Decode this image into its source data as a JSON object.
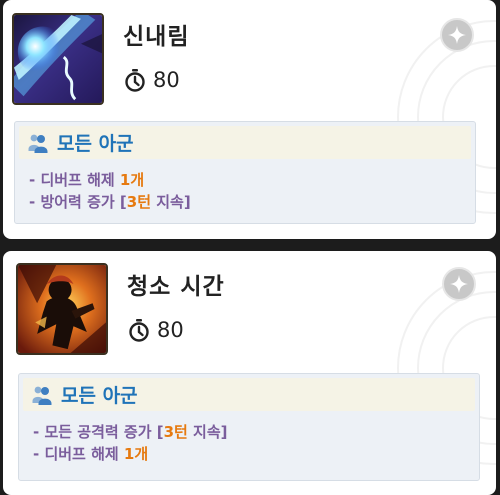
{
  "skills": [
    {
      "name": "신내림",
      "icon": "lightning-slash-icon",
      "cooldown": "80",
      "target": "모든 아군",
      "effects": [
        {
          "prefix": "- ",
          "text": "디버프 해제 ",
          "value": "1개",
          "suffix": ""
        },
        {
          "prefix": "- ",
          "text": "방어력 증가 [",
          "value": "3턴",
          "suffix": " 지속]"
        }
      ]
    },
    {
      "name": "청소 시간",
      "icon": "shadow-figure-icon",
      "cooldown": "80",
      "target": "모든 아군",
      "effects": [
        {
          "prefix": "- ",
          "text": "모든 공격력 증가 [",
          "value": "3턴",
          "suffix": " 지속]"
        },
        {
          "prefix": "- ",
          "text": "디버프 해제 ",
          "value": "1개",
          "suffix": ""
        }
      ]
    }
  ],
  "colors": {
    "target_text": "#1f73b8",
    "effect_text": "#7a5d9c",
    "highlight": "#e67a10"
  }
}
